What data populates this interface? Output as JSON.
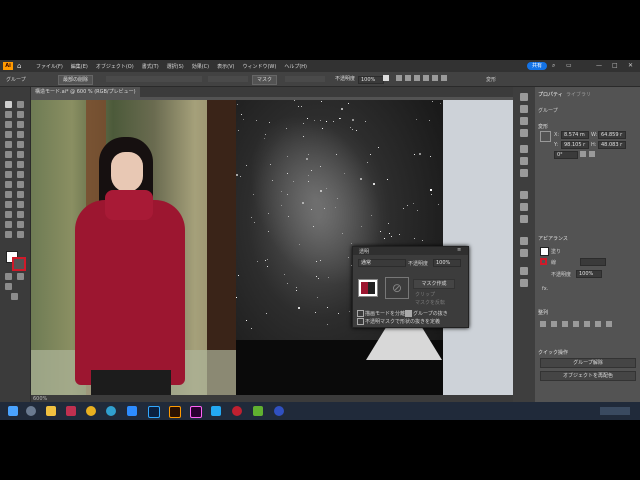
{
  "menubar": {
    "logo": "Ai",
    "items": [
      "ファイル(F)",
      "編集(E)",
      "オブジェクト(O)",
      "書式(T)",
      "選択(S)",
      "効果(C)",
      "表示(V)",
      "ウィンドウ(W)",
      "ヘルプ(H)"
    ],
    "share": "共有"
  },
  "control_bar": {
    "selection_label": "グループ",
    "edit_group_button": "最部の削除",
    "mask_button": "マスク",
    "opacity_label": "不透明度",
    "opacity_value": "100%",
    "transform_label": "変形"
  },
  "document": {
    "tab_title": "構造モード.ai* @ 600 % (RGB/プレビュー)",
    "zoom": "600%"
  },
  "properties_panel": {
    "tabs": [
      "プロパティ",
      "ライブラリ"
    ],
    "group_label": "グループ",
    "transform_title": "変形",
    "x_label": "X:",
    "x_value": "8.574 m",
    "y_label": "Y:",
    "y_value": "98.105 r",
    "w_label": "W:",
    "w_value": "64.859 r",
    "h_label": "H:",
    "h_value": "48.083 r",
    "rotation": "0°",
    "appearance_title": "アピアランス",
    "fill_label": "塗り",
    "stroke_label": "線",
    "opacity_label": "不透明度",
    "opacity_value": "100%",
    "fx_label": "fx.",
    "align_title": "整列",
    "quick_actions_title": "クイック操作",
    "ungroup_button": "グループ解除",
    "recolor_button": "オブジェクトを再配色"
  },
  "transparency_panel": {
    "title": "透明",
    "blend_mode": "通常",
    "opacity_label": "不透明度",
    "opacity_value": "100%",
    "make_mask_button": "マスク作成",
    "clip_label": "クリップ",
    "invert_label": "マスクを反転",
    "isolate_blending": "描画モードを分離",
    "knockout_group": "グループの抜き",
    "opacity_mask_knockout": "不透明マスクで形状の抜きを定義"
  },
  "taskbar": {
    "icons": [
      "start-icon",
      "search-icon",
      "file-explorer-icon",
      "media-icon",
      "chrome-icon",
      "edge-icon",
      "zoom-icon",
      "photoshop-icon",
      "illustrator-icon",
      "xd-icon",
      "vscode-icon",
      "red-app-icon",
      "green-app-icon",
      "blue-app-icon"
    ]
  },
  "colors": {
    "accent": "#1473e6",
    "ai_brand": "#ff9a00",
    "sweater": "#9c1630"
  }
}
